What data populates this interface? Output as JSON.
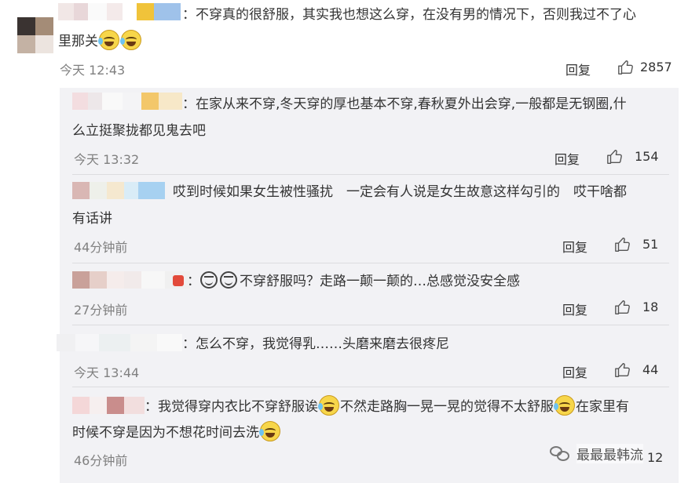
{
  "comments": [
    {
      "text_line1": "：不穿真的很舒服，其实我也想这么穿，在没有男的情况下，否则我过不了心",
      "text_line2": "里那关",
      "time": "今天 12:43",
      "reply": "回复",
      "likes": "2857"
    }
  ],
  "replies": [
    {
      "text_line1": "：在家从来不穿,冬天穿的厚也基本不穿,春秋夏外出会穿,一般都是无钢圈,什",
      "text_line2": "么立挺聚拢都见鬼去吧",
      "time": "今天 13:32",
      "reply": "回复",
      "likes": "154"
    },
    {
      "text_line1": "哎到时候如果女生被性骚扰　一定会有人说是女生故意这样勾引的　哎干啥都",
      "text_line2": "有话讲",
      "time": "44分钟前",
      "reply": "回复",
      "likes": "51"
    },
    {
      "text_line1": "不穿舒服吗？走路一颠一颠的…总感觉没安全感",
      "time": "27分钟前",
      "reply": "回复",
      "likes": "18"
    },
    {
      "text_line1": "：怎么不穿，我觉得乳……头磨来磨去很疼尼",
      "time": "今天 13:44",
      "reply": "回复",
      "likes": "44"
    },
    {
      "text_seg1": "：我觉得穿内衣比不穿舒服诶",
      "text_seg2": "不然走路胸一晃一晃的觉得不太舒服",
      "text_seg3": "在家里有",
      "text_line2": "时候不穿是因为不想花时间去洗",
      "time": "46分钟前",
      "reply": "回复",
      "likes": "12"
    }
  ],
  "watermark": {
    "text": "最最最韩流"
  },
  "icons": {
    "like": "thumbs-up-outline-icon",
    "laugh_cry": "laugh-crying-emoji-icon",
    "wechat": "wechat-icon"
  },
  "colors": {
    "sub_background": "#f2f2f5",
    "time_gray": "#808080",
    "text": "#333333"
  }
}
